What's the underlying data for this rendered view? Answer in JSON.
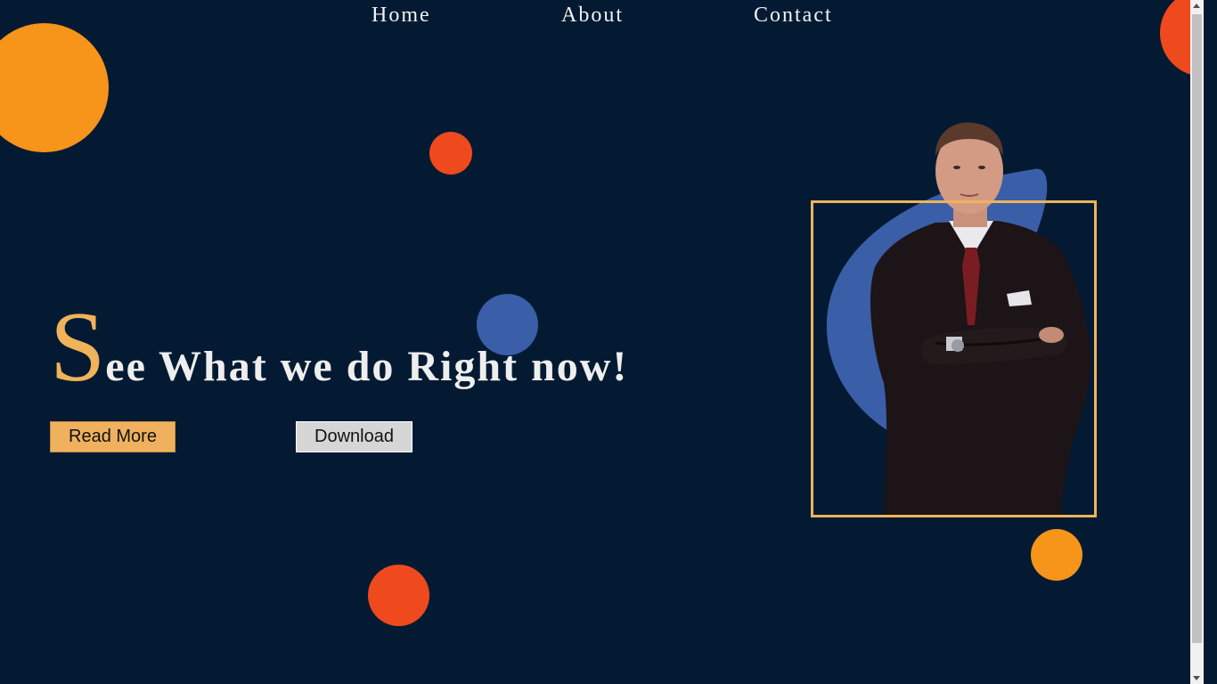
{
  "nav": {
    "items": [
      {
        "label": "Home"
      },
      {
        "label": "About"
      },
      {
        "label": "Contact"
      }
    ]
  },
  "hero": {
    "headline_initial": "S",
    "headline_rest": "ee What we do Right now!",
    "image_icon": "businessman-portrait"
  },
  "buttons": {
    "read_more": "Read More",
    "download": "Download"
  },
  "colors": {
    "background": "#041a33",
    "accent_gold": "#efb35a",
    "orange": "#f7941a",
    "red": "#ef4a1d",
    "blue": "#3b5ea8",
    "button_gray": "#d6d6d6"
  }
}
